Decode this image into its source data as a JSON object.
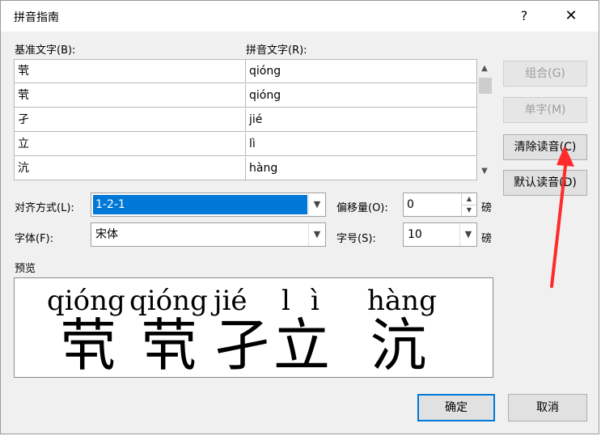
{
  "window": {
    "title": "拼音指南",
    "help_label": "?",
    "close_label": "✕"
  },
  "labels": {
    "base_text": "基准文字(B):",
    "pinyin_text": "拼音文字(R):",
    "alignment": "对齐方式(L):",
    "offset": "偏移量(O):",
    "font": "字体(F):",
    "size": "字号(S):",
    "unit_1": "磅",
    "unit_2": "磅",
    "preview": "预览"
  },
  "rows": [
    {
      "base": "茕",
      "pinyin": "qióng"
    },
    {
      "base": "茕",
      "pinyin": "qióng"
    },
    {
      "base": "孑",
      "pinyin": "jié"
    },
    {
      "base": "立",
      "pinyin": "lì"
    },
    {
      "base": "沆",
      "pinyin": "hàng"
    }
  ],
  "buttons": {
    "group": "组合(G)",
    "single": "单字(M)",
    "clear": "清除读音(C)",
    "default": "默认读音(D)",
    "ok": "确定",
    "cancel": "取消"
  },
  "fields": {
    "alignment": "1-2-1",
    "offset": "0",
    "font": "宋体",
    "size": "10"
  },
  "preview": {
    "pinyin": [
      "qióng",
      "qióng",
      "jié",
      "l",
      "ì",
      "hàng"
    ],
    "hanzi": [
      "茕",
      "茕",
      "孑",
      "立",
      "沆"
    ]
  },
  "icons": {
    "dropdown": "chevron-down-icon",
    "scroll_up": "chevron-up-icon",
    "scroll_down": "chevron-down-icon"
  },
  "colors": {
    "accent": "#0078d7",
    "annotation": "#ff2a2a"
  }
}
